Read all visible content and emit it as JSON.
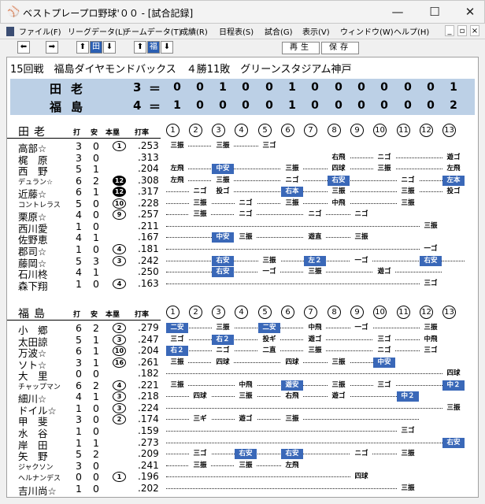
{
  "window": {
    "title": "ベストプレープロ野球'００ - [試合記録]",
    "minimize": "—",
    "maximize": "☐",
    "close": "✕"
  },
  "menu": [
    "ファイル(F)",
    "リーグデータ(L)",
    "チームデータ(T)",
    "成績(R)",
    "日程表(S)",
    "試合(G)",
    "表示(V)",
    "ウィンドウ(W)",
    "ヘルプ(H)"
  ],
  "mdi_buttons": [
    "_",
    "▫",
    "×"
  ],
  "toolbar": {
    "btns": [
      "⬅",
      "➡",
      "⬆",
      "田",
      "⬇",
      "⬆",
      "福",
      "⬇"
    ],
    "replay": "再生",
    "save": "保存"
  },
  "game": {
    "info": "15回戦　福島ダイヤモンドバックス　４勝11敗　グリーンスタジアム神戸",
    "eq": "＝",
    "lines": [
      {
        "team": "田老",
        "total": "3",
        "innings": [
          "0",
          "0",
          "1",
          "0",
          "0",
          "1",
          "0",
          "0",
          "0",
          "0",
          "0",
          "0",
          "1"
        ]
      },
      {
        "team": "福島",
        "total": "4",
        "innings": [
          "1",
          "0",
          "0",
          "0",
          "0",
          "1",
          "0",
          "0",
          "0",
          "0",
          "0",
          "0",
          "2"
        ]
      }
    ]
  },
  "headers": {
    "ab": "打",
    "h": "安",
    "hr": "本塁",
    "avg": "打率"
  },
  "inning_labels": [
    "1",
    "2",
    "3",
    "4",
    "5",
    "6",
    "7",
    "8",
    "9",
    "10",
    "11",
    "12",
    "13"
  ],
  "teams": [
    {
      "name": "田老",
      "players": [
        {
          "name": "高部☆",
          "ab": "3",
          "h": "0",
          "hr": "1",
          "hrb": false,
          "avg": ".253",
          "pa": {
            "1": "三振",
            "3": "三振",
            "5": "三ゴ"
          },
          "dots": [
            1,
            5
          ]
        },
        {
          "name": "梶　原",
          "ab": "3",
          "h": "0",
          "hr": "",
          "avg": ".313",
          "pa": {
            "8": "右飛",
            "10": "ニゴ",
            "13": "遊ゴ"
          },
          "dots": [
            8,
            13
          ]
        },
        {
          "name": "西　野",
          "ab": "5",
          "h": "1",
          "hr": "",
          "avg": ".204",
          "pa": {
            "1": "左飛",
            "3": "中安",
            "6": "三振",
            "8": "四球",
            "10": "三振",
            "13": "左飛"
          },
          "hits": [
            "3"
          ],
          "dots": [
            1,
            13
          ]
        },
        {
          "name": "デュラン☆",
          "small": true,
          "ab": "6",
          "h": "2",
          "hr": "12",
          "hrb": true,
          "avg": ".308",
          "pa": {
            "1": "左飛",
            "3": "三振",
            "6": "ニゴ",
            "8": "右安",
            "11": "ニゴ",
            "13": "左本"
          },
          "hits": [
            "8",
            "13"
          ],
          "dots": [
            1,
            13
          ]
        },
        {
          "name": "近藤☆",
          "ab": "6",
          "h": "1",
          "hr": "12",
          "hrb": true,
          "avg": ".317",
          "pa": {
            "2": "ニゴ",
            "3": "投ゴ",
            "6": "右本",
            "8": "三振",
            "11": "三振",
            "13": "投ゴ"
          },
          "hits": [
            "6"
          ],
          "dots": [
            1,
            13
          ]
        },
        {
          "name": "コントレラス",
          "small": true,
          "ab": "5",
          "h": "0",
          "hr": "10",
          "hrb": false,
          "avg": ".228",
          "pa": {
            "2": "三振",
            "4": "ニゴ",
            "6": "三振",
            "8": "中飛",
            "11": "三振"
          },
          "dots": [
            1,
            11
          ]
        },
        {
          "name": "栗原☆",
          "ab": "4",
          "h": "0",
          "hr": "9",
          "hrb": false,
          "avg": ".257",
          "pa": {
            "2": "三振",
            "4": "ニゴ",
            "7": "ニゴ",
            "9": "ニゴ"
          },
          "dots": [
            1,
            9
          ]
        },
        {
          "name": "西川愛",
          "ab": "1",
          "h": "0",
          "hr": "",
          "avg": ".211",
          "pa": {
            "12": "三振"
          },
          "dots": [
            1,
            12
          ]
        },
        {
          "name": "佐野恵",
          "ab": "4",
          "h": "1",
          "hr": "",
          "avg": ".167",
          "pa": {
            "3": "中安",
            "4": "三振",
            "7": "遊直",
            "9": "三振"
          },
          "hits": [
            "3"
          ],
          "dots": [
            1,
            9
          ]
        },
        {
          "name": "郡司☆",
          "ab": "1",
          "h": "0",
          "hr": "4",
          "hrb": false,
          "avg": ".181",
          "pa": {
            "12": "一ゴ"
          },
          "dots": [
            1,
            12
          ]
        },
        {
          "name": "藤岡☆",
          "ab": "5",
          "h": "3",
          "hr": "3",
          "hrb": false,
          "avg": ".242",
          "pa": {
            "3": "右安",
            "5": "三振",
            "7": "左２",
            "9": "一ゴ",
            "12": "右安"
          },
          "hits": [
            "3",
            "7",
            "12"
          ],
          "dots": [
            1,
            13
          ]
        },
        {
          "name": "石川柊",
          "ab": "4",
          "h": "1",
          "hr": "",
          "avg": ".250",
          "pa": {
            "3": "右安",
            "5": "一ゴ",
            "7": "三振",
            "10": "遊ゴ"
          },
          "hits": [
            "3"
          ],
          "dots": [
            1,
            12
          ]
        },
        {
          "name": "森下翔",
          "ab": "1",
          "h": "0",
          "hr": "4",
          "hrb": false,
          "avg": ".163",
          "pa": {
            "12": "三ゴ"
          },
          "dots": [
            1,
            12
          ]
        }
      ]
    },
    {
      "name": "福島",
      "players": [
        {
          "name": "小　郷",
          "ab": "6",
          "h": "2",
          "hr": "2",
          "hrb": false,
          "avg": ".279",
          "pa": {
            "1": "二安",
            "3": "三振",
            "5": "二安",
            "7": "中飛",
            "9": "一ゴ",
            "12": "三振"
          },
          "hits": [
            "1",
            "5"
          ],
          "dots": [
            1,
            12
          ]
        },
        {
          "name": "太田諒",
          "ab": "5",
          "h": "1",
          "hr": "3",
          "hrb": false,
          "avg": ".247",
          "pa": {
            "1": "三ゴ",
            "3": "右２",
            "5": "投ギ",
            "7": "遊ゴ",
            "10": "三ゴ",
            "12": "中飛"
          },
          "hits": [
            "3"
          ],
          "dots": [
            1,
            12
          ]
        },
        {
          "name": "万波☆",
          "ab": "6",
          "h": "1",
          "hr": "10",
          "hrb": false,
          "avg": ".204",
          "pa": {
            "1": "右２",
            "3": "ニゴ",
            "5": "二直",
            "7": "三振",
            "10": "ニゴ",
            "12": "三ゴ"
          },
          "hits": [
            "1"
          ],
          "dots": [
            1,
            12
          ]
        },
        {
          "name": "ソト☆",
          "ab": "3",
          "h": "1",
          "hr": "16",
          "hrb": false,
          "avg": ".261",
          "pa": {
            "1": "三振",
            "3": "四球",
            "6": "四球",
            "8": "三振",
            "10": "中安"
          },
          "hits": [
            "10"
          ],
          "dots": [
            1,
            10
          ]
        },
        {
          "name": "大　里",
          "ab": "0",
          "h": "0",
          "hr": "",
          "avg": ".182",
          "pa": {
            "13": "四球"
          },
          "dots": [
            1,
            13
          ]
        },
        {
          "name": "チャップマン",
          "small": true,
          "ab": "6",
          "h": "2",
          "hr": "4",
          "hrb": false,
          "avg": ".221",
          "pa": {
            "1": "三振",
            "4": "中飛",
            "6": "遊安",
            "8": "三振",
            "10": "三ゴ",
            "13": "中２"
          },
          "hits": [
            "6",
            "13"
          ],
          "dots": [
            1,
            13
          ]
        },
        {
          "name": "細川☆",
          "ab": "4",
          "h": "1",
          "hr": "3",
          "hrb": false,
          "avg": ".218",
          "pa": {
            "2": "四球",
            "4": "三振",
            "6": "右飛",
            "8": "遊ゴ",
            "11": "中２"
          },
          "hits": [
            "11"
          ],
          "dots": [
            1,
            11
          ]
        },
        {
          "name": "ドイル☆",
          "ab": "1",
          "h": "0",
          "hr": "3",
          "hrb": false,
          "avg": ".224",
          "pa": {
            "13": "三振"
          },
          "dots": [
            1,
            13
          ]
        },
        {
          "name": "甲　斐",
          "ab": "3",
          "h": "0",
          "hr": "2",
          "hrb": false,
          "avg": ".174",
          "pa": {
            "2": "三ギ",
            "4": "遊ゴ",
            "6": "三振"
          },
          "dots": [
            1,
            11
          ]
        },
        {
          "name": "水　谷",
          "ab": "1",
          "h": "0",
          "hr": "",
          "avg": ".159",
          "pa": {
            "11": "三ゴ"
          },
          "dots": [
            1,
            11
          ]
        },
        {
          "name": "岸　田",
          "ab": "1",
          "h": "1",
          "hr": "",
          "avg": ".273",
          "pa": {
            "13": "右安"
          },
          "hits": [
            "13"
          ],
          "dots": [
            1,
            13
          ]
        },
        {
          "name": "矢　野",
          "ab": "5",
          "h": "2",
          "hr": "",
          "avg": ".209",
          "pa": {
            "2": "三ゴ",
            "4": "右安",
            "6": "右安",
            "9": "ニゴ",
            "11": "三振"
          },
          "hits": [
            "4",
            "6"
          ],
          "dots": [
            1,
            11
          ]
        },
        {
          "name": "ジャクソン",
          "small": true,
          "ab": "3",
          "h": "0",
          "hr": "",
          "avg": ".241",
          "pa": {
            "2": "三振",
            "4": "三振",
            "6": "左飛"
          },
          "dots": [
            1,
            6
          ]
        },
        {
          "name": "ヘルナンデス",
          "small": true,
          "ab": "0",
          "h": "0",
          "hr": "1",
          "hrb": false,
          "avg": ".196",
          "pa": {
            "9": "四球"
          },
          "dots": [
            1,
            9
          ]
        },
        {
          "name": "吉川尚☆",
          "ab": "1",
          "h": "0",
          "hr": "",
          "avg": ".202",
          "pa": {
            "11": "三振"
          },
          "dots": [
            1,
            11
          ]
        }
      ]
    }
  ]
}
